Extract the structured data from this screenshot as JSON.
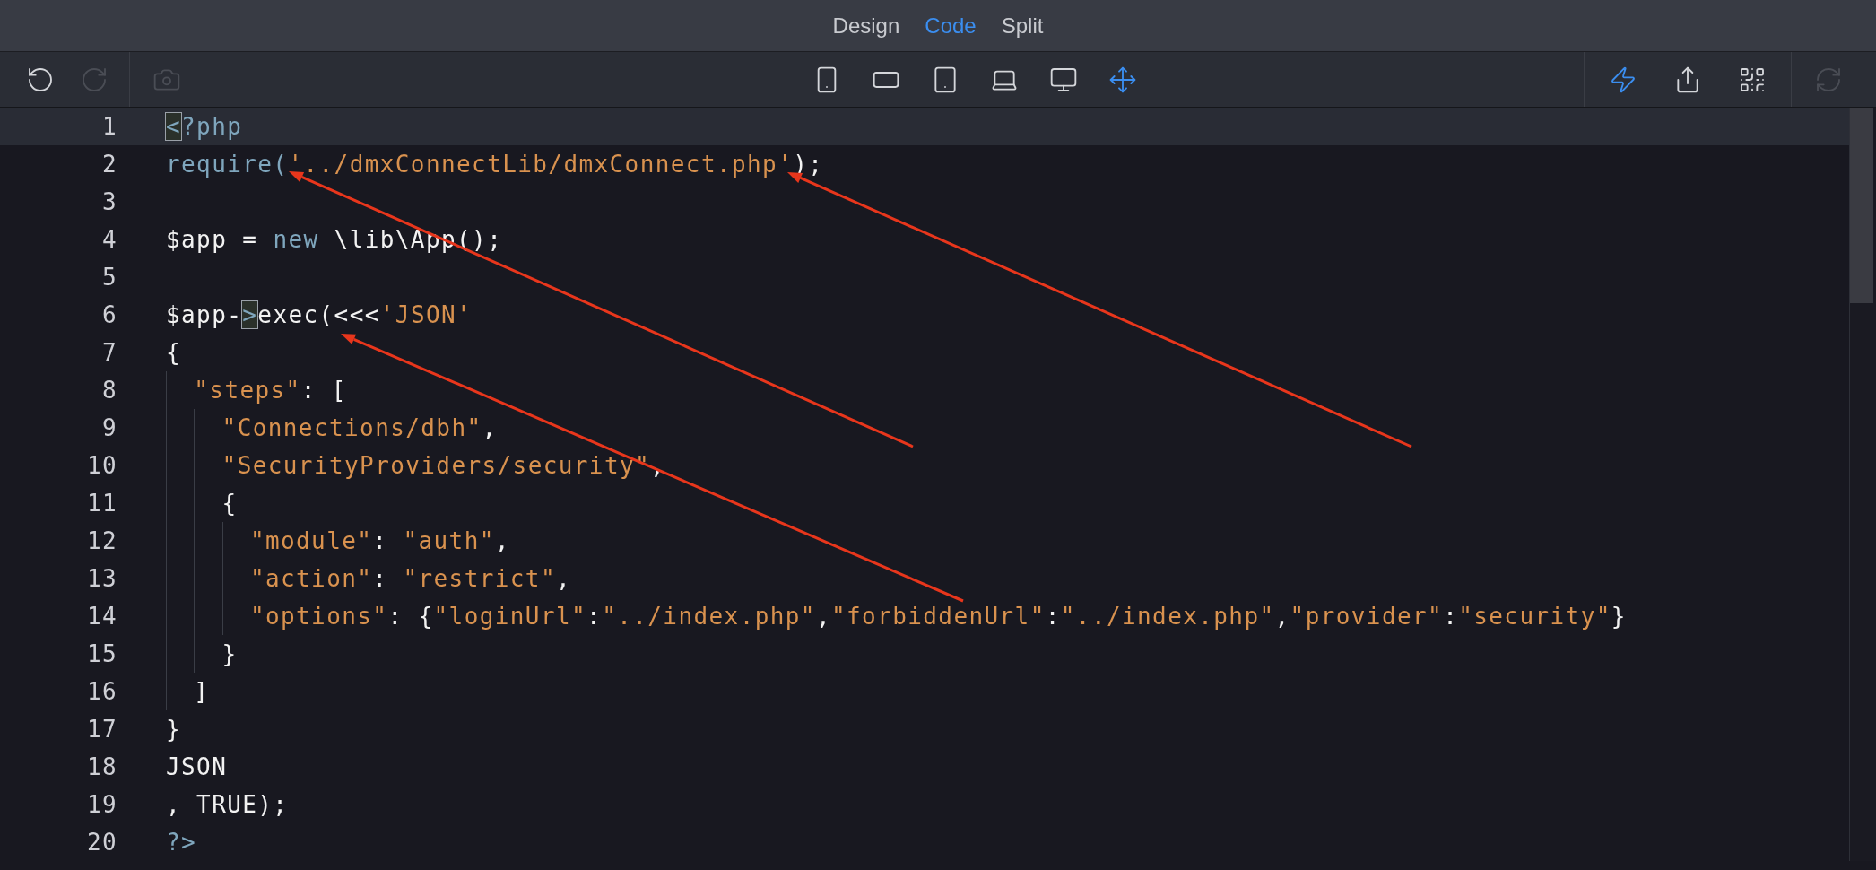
{
  "view_tabs": [
    {
      "label": "Design",
      "selected": false
    },
    {
      "label": "Code",
      "selected": true
    },
    {
      "label": "Split",
      "selected": false
    }
  ],
  "toolbar": {
    "history": [
      {
        "kind": "undo",
        "disabled": false
      },
      {
        "kind": "redo",
        "disabled": true
      }
    ],
    "capture": {
      "kind": "camera",
      "disabled": true
    },
    "devices": [
      {
        "kind": "phone",
        "selected": false
      },
      {
        "kind": "tablet-landscape",
        "selected": false
      },
      {
        "kind": "tablet",
        "selected": false
      },
      {
        "kind": "laptop",
        "selected": false
      },
      {
        "kind": "desktop",
        "selected": false
      },
      {
        "kind": "resize",
        "selected": true
      }
    ],
    "actions": [
      {
        "kind": "lightning",
        "active": true
      },
      {
        "kind": "share",
        "active": false
      },
      {
        "kind": "qrcode",
        "active": false
      },
      {
        "kind": "refresh",
        "disabled": true
      }
    ]
  },
  "editor": {
    "lines": [
      {
        "number": "1",
        "active": true,
        "segments": [
          {
            "kind": "match",
            "text": "<"
          },
          {
            "kind": "keyword",
            "text": "?php"
          }
        ]
      },
      {
        "number": "2",
        "active": false,
        "segments": [
          {
            "kind": "keyword",
            "text": "require("
          },
          {
            "kind": "string",
            "text": "'../dmxConnectLib/dmxConnect.php'"
          },
          {
            "kind": "plain",
            "text": ");"
          }
        ]
      },
      {
        "number": "3",
        "active": false
      },
      {
        "number": "4",
        "active": false,
        "segments": [
          {
            "kind": "plain",
            "text": "$app = "
          },
          {
            "kind": "keyword",
            "text": "new"
          },
          {
            "kind": "plain",
            "text": " \\lib\\App();"
          }
        ]
      },
      {
        "number": "5",
        "active": false
      },
      {
        "number": "6",
        "active": false,
        "segments": [
          {
            "kind": "plain",
            "text": "$app-"
          },
          {
            "kind": "match",
            "text": ">"
          },
          {
            "kind": "plain",
            "text": "exec(<<<"
          },
          {
            "kind": "string",
            "text": "'JSON'"
          }
        ]
      },
      {
        "number": "7",
        "active": false,
        "segments": [
          {
            "kind": "plain",
            "text": "{"
          }
        ]
      },
      {
        "number": "8",
        "active": false,
        "segments": [
          {
            "kind": "string",
            "text": "  \"steps\""
          },
          {
            "kind": "plain",
            "text": ": ["
          }
        ]
      },
      {
        "number": "9",
        "active": false,
        "segments": [
          {
            "kind": "string",
            "text": "    \"Connections/dbh\""
          },
          {
            "kind": "plain",
            "text": ","
          }
        ]
      },
      {
        "number": "10",
        "active": false,
        "segments": [
          {
            "kind": "string",
            "text": "    \"SecurityProviders/security\""
          },
          {
            "kind": "plain",
            "text": ","
          }
        ]
      },
      {
        "number": "11",
        "active": false,
        "segments": [
          {
            "kind": "plain",
            "text": "    {"
          }
        ]
      },
      {
        "number": "12",
        "active": false,
        "segments": [
          {
            "kind": "string",
            "text": "      \"module\""
          },
          {
            "kind": "plain",
            "text": ": "
          },
          {
            "kind": "string",
            "text": "\"auth\""
          },
          {
            "kind": "plain",
            "text": ","
          }
        ]
      },
      {
        "number": "13",
        "active": false,
        "segments": [
          {
            "kind": "string",
            "text": "      \"action\""
          },
          {
            "kind": "plain",
            "text": ": "
          },
          {
            "kind": "string",
            "text": "\"restrict\""
          },
          {
            "kind": "plain",
            "text": ","
          }
        ]
      },
      {
        "number": "14",
        "active": false,
        "segments": [
          {
            "kind": "string",
            "text": "      \"options\""
          },
          {
            "kind": "plain",
            "text": ": {"
          },
          {
            "kind": "string",
            "text": "\"loginUrl\""
          },
          {
            "kind": "plain",
            "text": ":"
          },
          {
            "kind": "string",
            "text": "\"../index.php\""
          },
          {
            "kind": "plain",
            "text": ","
          },
          {
            "kind": "string",
            "text": "\"forbiddenUrl\""
          },
          {
            "kind": "plain",
            "text": ":"
          },
          {
            "kind": "string",
            "text": "\"../index.php\""
          },
          {
            "kind": "plain",
            "text": ","
          },
          {
            "kind": "string",
            "text": "\"provider\""
          },
          {
            "kind": "plain",
            "text": ":"
          },
          {
            "kind": "string",
            "text": "\"security\""
          },
          {
            "kind": "plain",
            "text": "}"
          }
        ]
      },
      {
        "number": "15",
        "active": false,
        "segments": [
          {
            "kind": "plain",
            "text": "    }"
          }
        ]
      },
      {
        "number": "16",
        "active": false,
        "segments": [
          {
            "kind": "plain",
            "text": "  ]"
          }
        ]
      },
      {
        "number": "17",
        "active": false,
        "segments": [
          {
            "kind": "plain",
            "text": "}"
          }
        ]
      },
      {
        "number": "18",
        "active": false,
        "segments": [
          {
            "kind": "plain",
            "text": "JSON"
          }
        ]
      },
      {
        "number": "19",
        "active": false,
        "segments": [
          {
            "kind": "plain",
            "text": ", TRUE);"
          }
        ]
      },
      {
        "number": "20",
        "active": false,
        "segments": [
          {
            "kind": "keyword",
            "text": "?>"
          }
        ]
      }
    ]
  }
}
